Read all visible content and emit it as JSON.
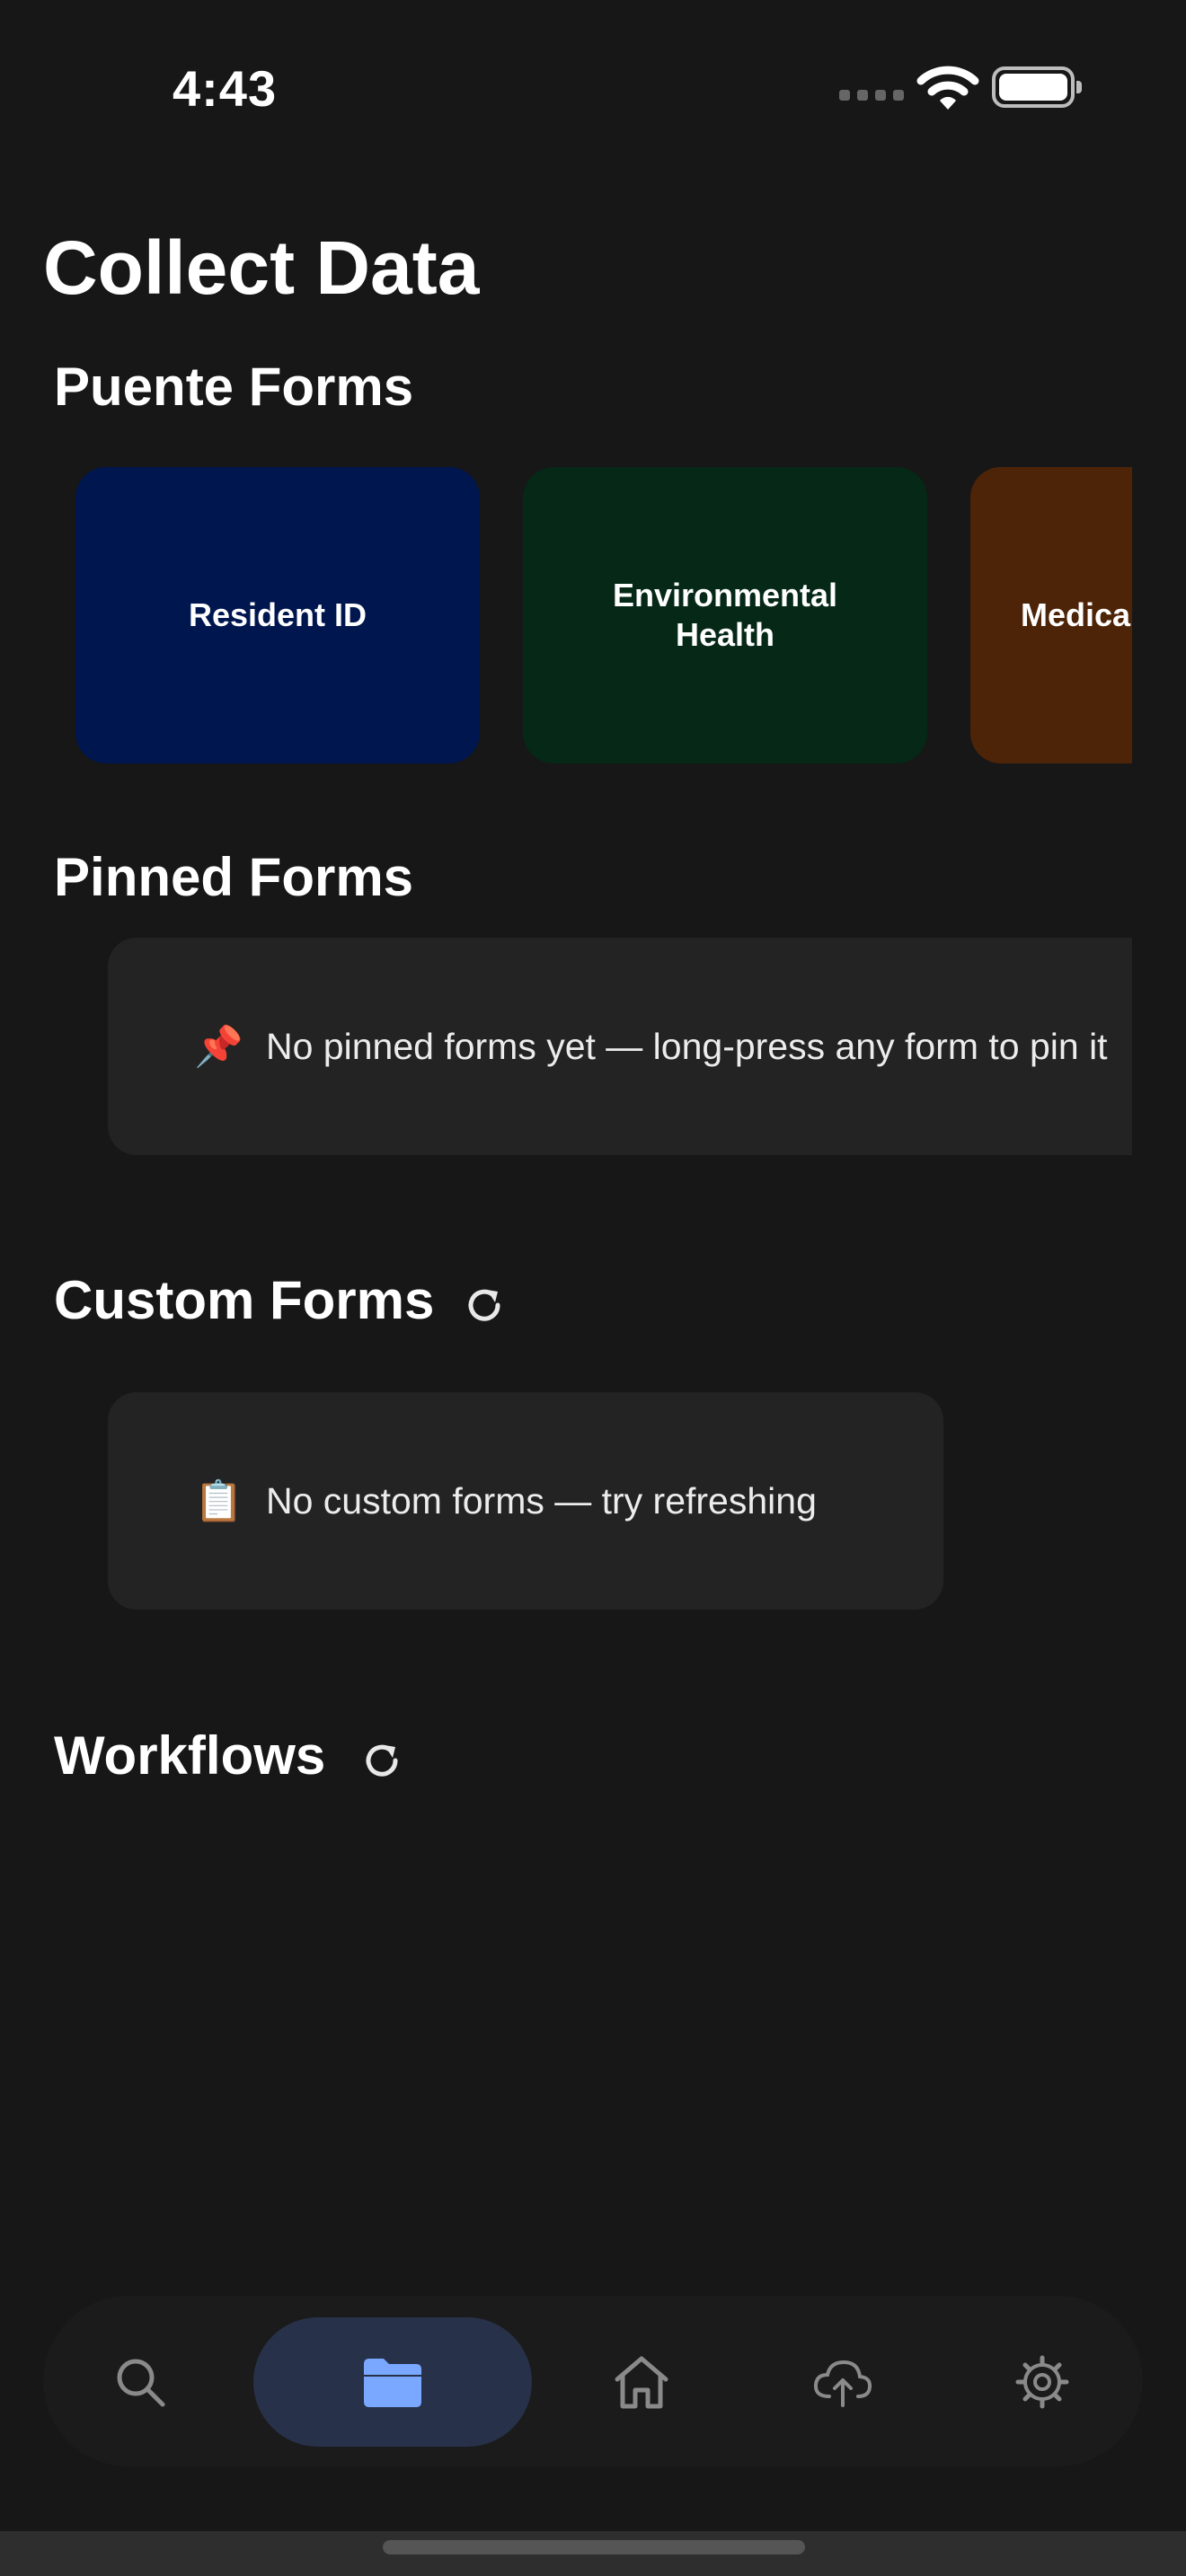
{
  "status": {
    "time": "4:43"
  },
  "page": {
    "title": "Collect Data"
  },
  "puente": {
    "title": "Puente Forms",
    "forms": [
      {
        "label": "Resident ID",
        "color": "#00164f"
      },
      {
        "label": "Environmental Health",
        "color": "#052817"
      },
      {
        "label": "Medical",
        "color": "#4e2408"
      }
    ]
  },
  "pinned": {
    "title": "Pinned Forms",
    "empty_icon": "pushpin-icon",
    "empty_emoji": "📌",
    "empty_text": "No pinned forms yet — long-press any form to pin it"
  },
  "custom": {
    "title": "Custom Forms",
    "empty_icon": "clipboard-icon",
    "empty_emoji": "📋",
    "empty_text": "No custom forms — try refreshing"
  },
  "workflows": {
    "title": "Workflows"
  },
  "nav": {
    "items": [
      {
        "name": "search-icon",
        "active": false
      },
      {
        "name": "folder-icon",
        "active": true
      },
      {
        "name": "home-icon",
        "active": false
      },
      {
        "name": "cloud-upload-icon",
        "active": false
      },
      {
        "name": "gear-icon",
        "active": false
      }
    ],
    "accent": "#7aa7ff"
  }
}
